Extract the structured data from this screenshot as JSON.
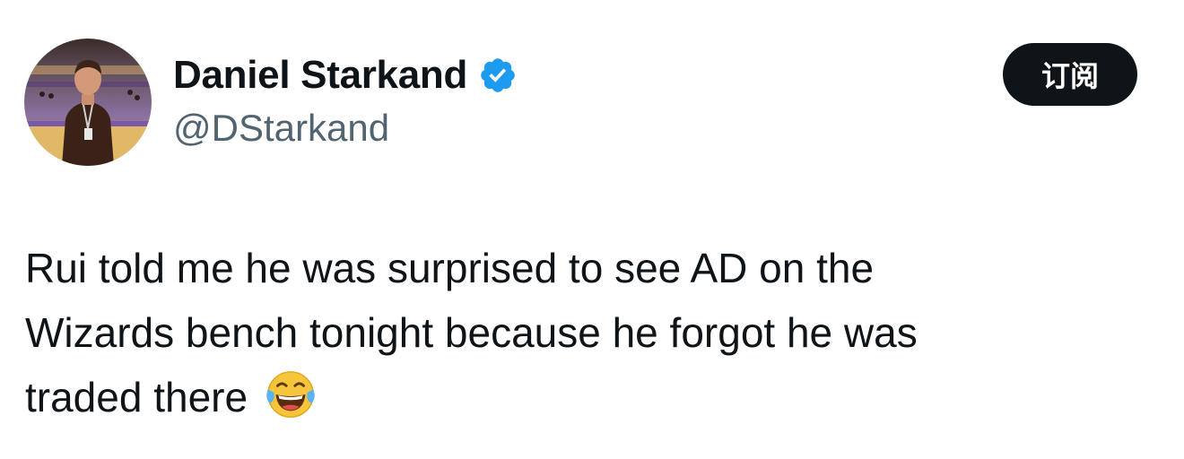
{
  "author": {
    "display_name": "Daniel Starkand",
    "handle": "@DStarkand",
    "verified": true,
    "avatar_icon": "profile-photo"
  },
  "actions": {
    "subscribe_label": "订阅"
  },
  "tweet": {
    "lines": [
      "Rui told me he was surprised to see AD on the",
      "Wizards bench tonight because he forgot he was",
      "traded there"
    ],
    "emoji": "face-with-tears-of-joy-icon"
  },
  "colors": {
    "text_primary": "#0f1419",
    "text_secondary": "#536471",
    "verified_blue": "#1d9bf0",
    "button_bg": "#0f1419",
    "button_text": "#ffffff",
    "background": "#ffffff"
  }
}
